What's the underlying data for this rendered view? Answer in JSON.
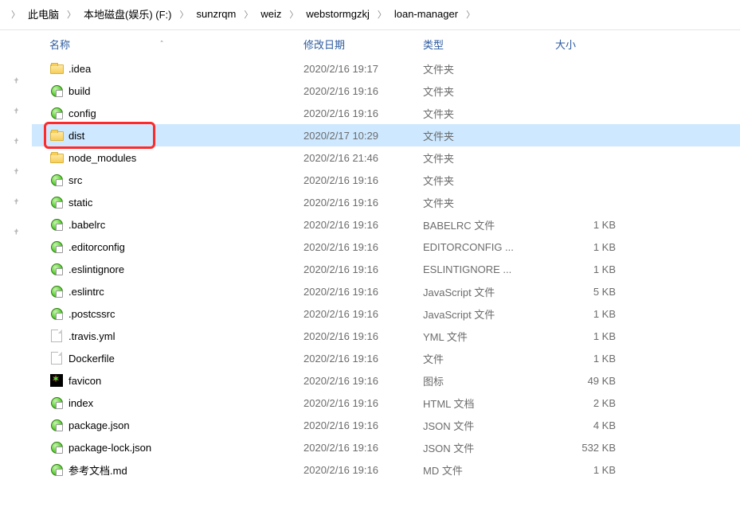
{
  "breadcrumb": [
    "此电脑",
    "本地磁盘(娱乐) (F:)",
    "sunzrqm",
    "weiz",
    "webstormgzkj",
    "loan-manager"
  ],
  "columns": {
    "name": "名称",
    "date": "修改日期",
    "type": "类型",
    "size": "大小"
  },
  "rows": [
    {
      "icon": "folder",
      "name": ".idea",
      "date": "2020/2/16 19:17",
      "type": "文件夹",
      "size": ""
    },
    {
      "icon": "disc",
      "name": "build",
      "date": "2020/2/16 19:16",
      "type": "文件夹",
      "size": ""
    },
    {
      "icon": "disc",
      "name": "config",
      "date": "2020/2/16 19:16",
      "type": "文件夹",
      "size": ""
    },
    {
      "icon": "folder",
      "name": "dist",
      "date": "2020/2/17 10:29",
      "type": "文件夹",
      "size": "",
      "selected": true
    },
    {
      "icon": "folder",
      "name": "node_modules",
      "date": "2020/2/16 21:46",
      "type": "文件夹",
      "size": ""
    },
    {
      "icon": "disc",
      "name": "src",
      "date": "2020/2/16 19:16",
      "type": "文件夹",
      "size": ""
    },
    {
      "icon": "disc",
      "name": "static",
      "date": "2020/2/16 19:16",
      "type": "文件夹",
      "size": ""
    },
    {
      "icon": "disc",
      "name": ".babelrc",
      "date": "2020/2/16 19:16",
      "type": "BABELRC 文件",
      "size": "1 KB"
    },
    {
      "icon": "disc",
      "name": ".editorconfig",
      "date": "2020/2/16 19:16",
      "type": "EDITORCONFIG ...",
      "size": "1 KB"
    },
    {
      "icon": "disc",
      "name": ".eslintignore",
      "date": "2020/2/16 19:16",
      "type": "ESLINTIGNORE ...",
      "size": "1 KB"
    },
    {
      "icon": "disc",
      "name": ".eslintrc",
      "date": "2020/2/16 19:16",
      "type": "JavaScript 文件",
      "size": "5 KB"
    },
    {
      "icon": "disc",
      "name": ".postcssrc",
      "date": "2020/2/16 19:16",
      "type": "JavaScript 文件",
      "size": "1 KB"
    },
    {
      "icon": "page",
      "name": ".travis.yml",
      "date": "2020/2/16 19:16",
      "type": "YML 文件",
      "size": "1 KB"
    },
    {
      "icon": "page",
      "name": "Dockerfile",
      "date": "2020/2/16 19:16",
      "type": "文件",
      "size": "1 KB"
    },
    {
      "icon": "fav",
      "name": "favicon",
      "date": "2020/2/16 19:16",
      "type": "图标",
      "size": "49 KB"
    },
    {
      "icon": "disc",
      "name": "index",
      "date": "2020/2/16 19:16",
      "type": "HTML 文档",
      "size": "2 KB"
    },
    {
      "icon": "disc",
      "name": "package.json",
      "date": "2020/2/16 19:16",
      "type": "JSON 文件",
      "size": "4 KB"
    },
    {
      "icon": "disc",
      "name": "package-lock.json",
      "date": "2020/2/16 19:16",
      "type": "JSON 文件",
      "size": "532 KB"
    },
    {
      "icon": "disc",
      "name": "参考文档.md",
      "date": "2020/2/16 19:16",
      "type": "MD 文件",
      "size": "1 KB"
    }
  ],
  "pins": 6
}
